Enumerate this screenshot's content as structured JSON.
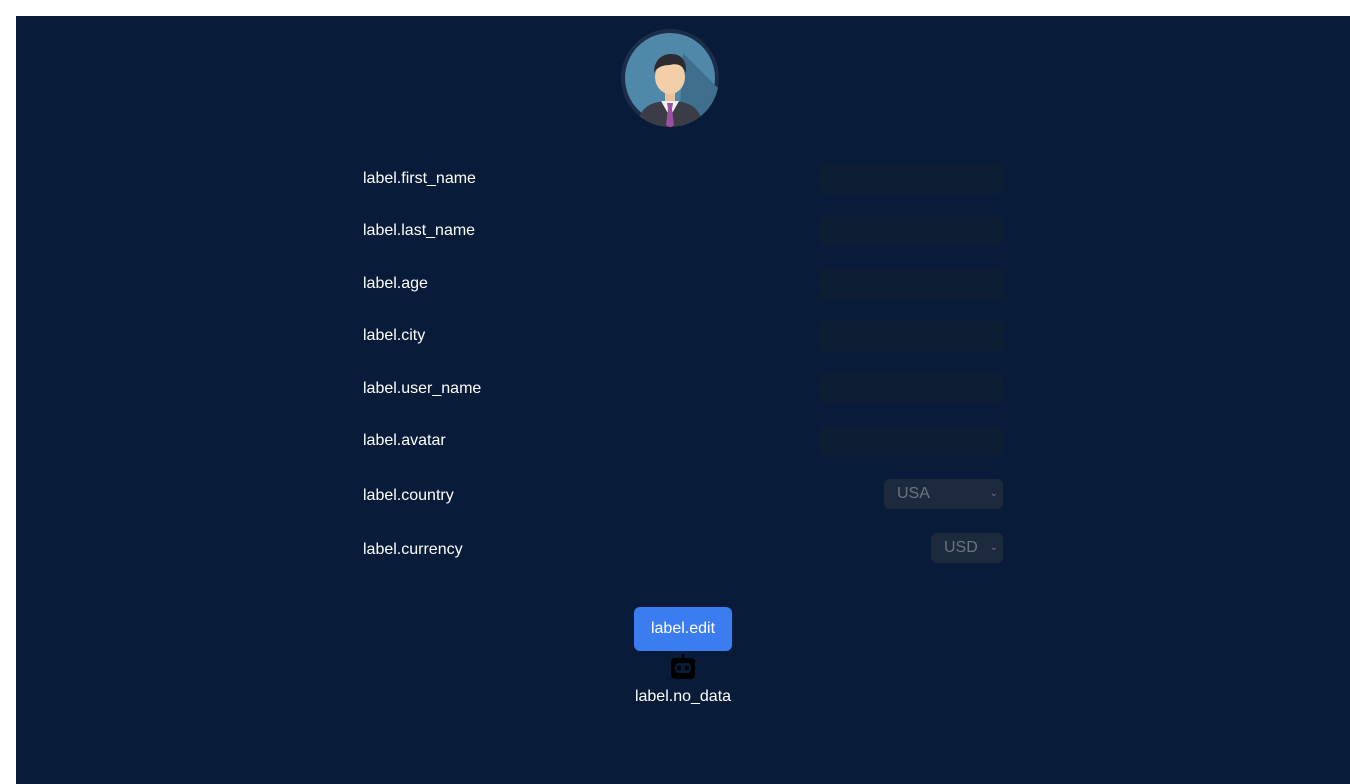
{
  "profile": {
    "avatar_icon": "user-avatar-icon"
  },
  "form": {
    "fields": [
      {
        "label": "label.first_name",
        "value": ""
      },
      {
        "label": "label.last_name",
        "value": ""
      },
      {
        "label": "label.age",
        "value": ""
      },
      {
        "label": "label.city",
        "value": ""
      },
      {
        "label": "label.user_name",
        "value": ""
      },
      {
        "label": "label.avatar",
        "value": ""
      }
    ],
    "country": {
      "label": "label.country",
      "value": "USA"
    },
    "currency": {
      "label": "label.currency",
      "value": "USD"
    }
  },
  "actions": {
    "edit_label": "label.edit"
  },
  "empty_state": {
    "icon": "robot-icon",
    "label": "label.no_data"
  },
  "colors": {
    "background": "#081b39",
    "accent": "#3b7cf0",
    "input_bg": "#0d1d33",
    "select_bg": "#1d2a3d"
  }
}
